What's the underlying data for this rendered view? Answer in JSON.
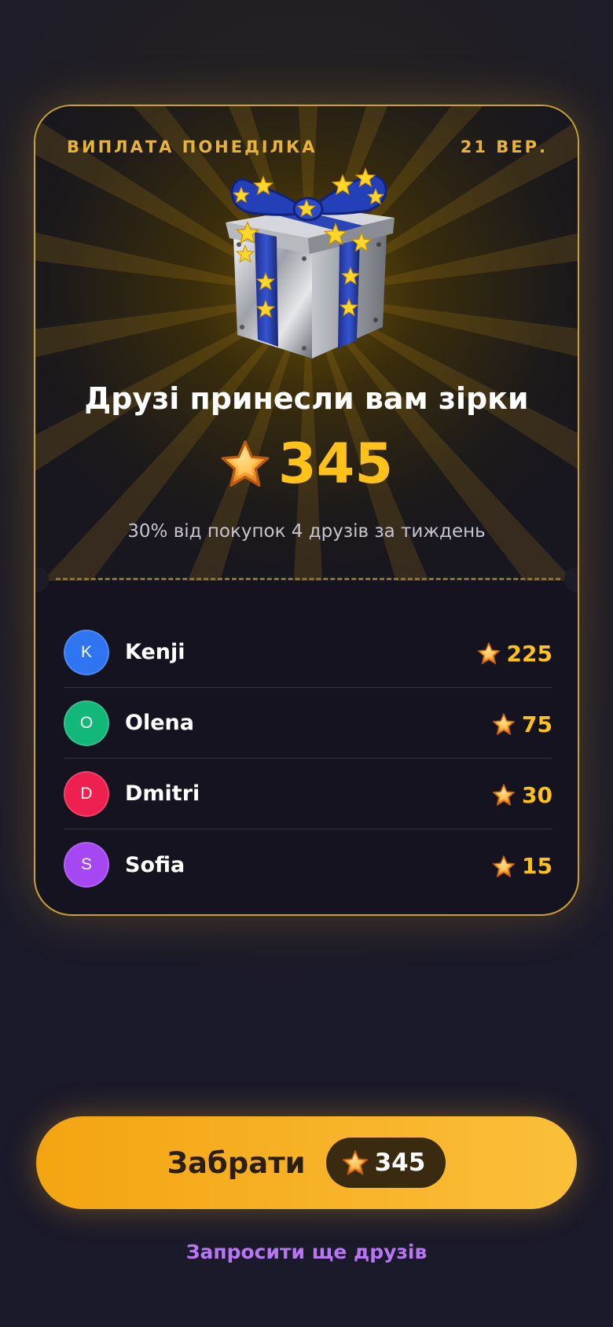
{
  "card": {
    "header_left": "ВИПЛАТА ПОНЕДІЛКА",
    "header_right": "21 ВЕР.",
    "title": "Друзі принесли вам зірки",
    "amount": "345",
    "subtitle": "30% від покупок 4 друзів за тиждень",
    "gift_icon": "gift-box-icon"
  },
  "friends": [
    {
      "initial": "K",
      "name": "Kenji",
      "stars": "225",
      "color": "#2f74f0"
    },
    {
      "initial": "O",
      "name": "Olena",
      "stars": "75",
      "color": "#12b77a"
    },
    {
      "initial": "D",
      "name": "Dmitri",
      "stars": "30",
      "color": "#ee2050"
    },
    {
      "initial": "S",
      "name": "Sofia",
      "stars": "15",
      "color": "#a547f3"
    }
  ],
  "claim": {
    "label": "Забрати",
    "amount": "345"
  },
  "invite_label": "Запросити ще друзів",
  "colors": {
    "accent_gold": "#ffc21a",
    "border_gold": "#c9a22a",
    "button": "#f8b42a",
    "invite": "#b777f0"
  }
}
